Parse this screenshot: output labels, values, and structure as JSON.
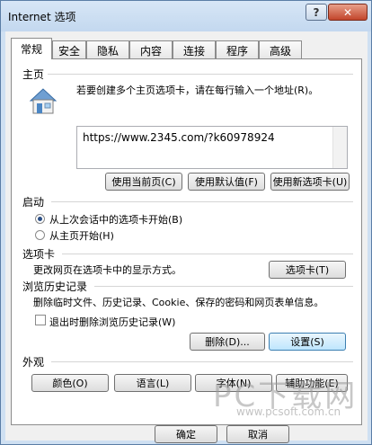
{
  "window": {
    "title": "Internet 选项",
    "help_label": "?",
    "close_label": "✕"
  },
  "tabs": [
    "常规",
    "安全",
    "隐私",
    "内容",
    "连接",
    "程序",
    "高级"
  ],
  "homepage": {
    "section_label": "主页",
    "description": "若要创建多个主页选项卡，请在每行输入一个地址(R)。",
    "url": "https://www.2345.com/?k60978924",
    "buttons": [
      "使用当前页(C)",
      "使用默认值(F)",
      "使用新选项卡(U)"
    ]
  },
  "startup": {
    "section_label": "启动",
    "options": [
      {
        "label": "从上次会话中的选项卡开始(B)",
        "checked": true
      },
      {
        "label": "从主页开始(H)",
        "checked": false
      }
    ]
  },
  "tabs_section": {
    "section_label": "选项卡",
    "description": "更改网页在选项卡中的显示方式。",
    "button": "选项卡(T)"
  },
  "history": {
    "section_label": "浏览历史记录",
    "description": "删除临时文件、历史记录、Cookie、保存的密码和网页表单信息。",
    "checkbox_label": "退出时删除浏览历史记录(W)",
    "checkbox_checked": false,
    "delete_button": "删除(D)...",
    "settings_button": "设置(S)"
  },
  "appearance": {
    "section_label": "外观",
    "buttons": [
      "颜色(O)",
      "语言(L)",
      "字体(N)",
      "辅助功能(E)"
    ]
  },
  "footer": {
    "ok": "确定",
    "cancel": "取消"
  },
  "watermark": {
    "main": "PC下载网",
    "url": "www.pcsoft.com.cn"
  }
}
